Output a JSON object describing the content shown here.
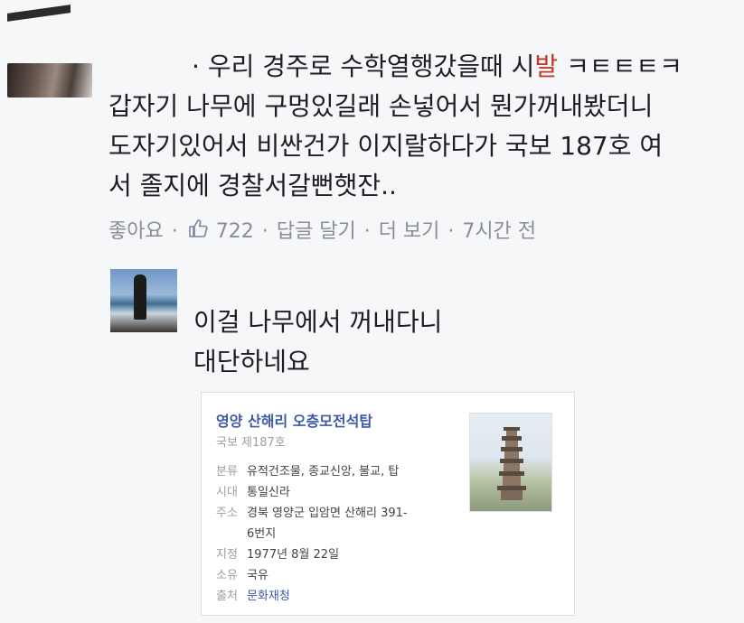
{
  "comment1": {
    "line1_dot": "·",
    "line1_text": "우리 경주로 수학열행갔을때 시",
    "line1_censored": "발",
    "line1_tail": " ㅋㅌㅌㅌㅋ",
    "line2": "갑자기 나무에 구멍있길래 손넣어서 뭔가꺼내봤더니",
    "line3": "도자기있어서 비싼건가 이지랄하다가 국보 187호 여",
    "line4": "서 졸지에 경찰서갈뻔햇잔.."
  },
  "meta": {
    "like": "좋아요",
    "like_count": "722",
    "reply": "답글 달기",
    "more": "더 보기",
    "time": "7시간 전",
    "sep": "·"
  },
  "comment2": {
    "line1": "이걸 나무에서 꺼내다니",
    "line2": "대단하네요"
  },
  "card": {
    "title": "영양 산해리 오층모전석탑",
    "subtitle": "국보 제187호",
    "rows": [
      {
        "k": "분류",
        "v": "유적건조물, 종교신앙, 불교, 탑"
      },
      {
        "k": "시대",
        "v": "통일신라"
      },
      {
        "k": "주소",
        "v": "경북 영양군 입암면 산해리 391-"
      },
      {
        "k": "",
        "v": "6번지"
      },
      {
        "k": "지정",
        "v": "1977년 8월 22일"
      },
      {
        "k": "소유",
        "v": "국유"
      },
      {
        "k": "출처",
        "v": "문화재청"
      }
    ]
  },
  "icons": {
    "like": "thumbs-up-icon"
  }
}
